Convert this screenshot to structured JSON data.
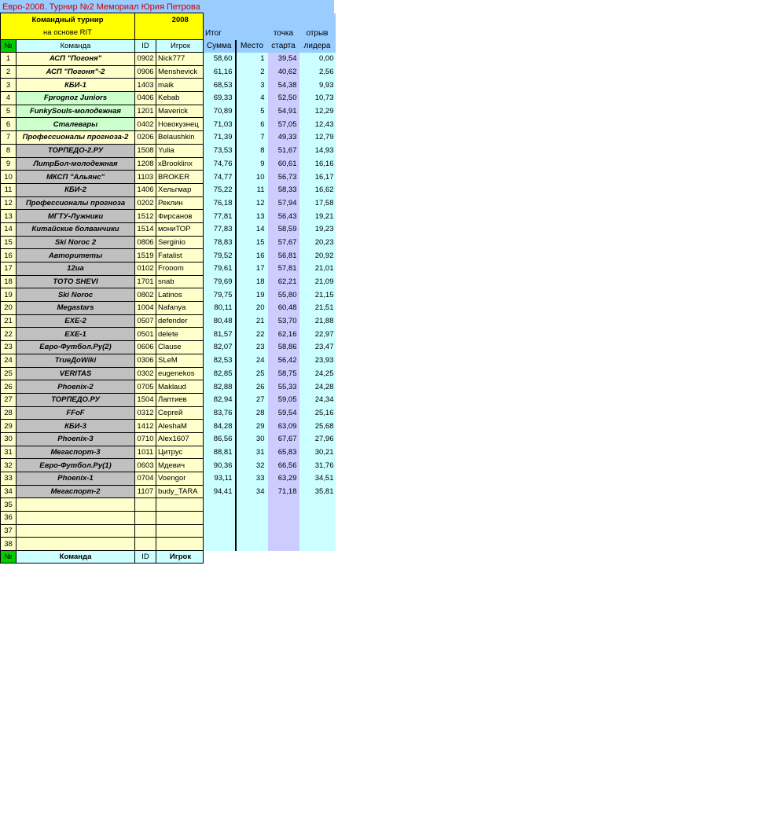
{
  "title": "Евро-2008. Турнир №2 Мемориал Юрия Петрова",
  "header": {
    "team_line1": "Командный турнир",
    "team_line2": "на основе RIT",
    "year": "2008",
    "col_num": "№",
    "col_team": "Команда",
    "col_id": "ID",
    "col_player": "Игрок",
    "itog": "Итог",
    "summa": "Сумма",
    "mesto": "Место",
    "tochka": "точка",
    "starta": "старта",
    "otryv": "отрыв",
    "lidera": "лидера"
  },
  "rows": [
    {
      "n": "1",
      "team": "АСП \"Погоня\"",
      "id": "0902",
      "player": "Nick777",
      "sum": "58,60",
      "place": "1",
      "start": "39,54",
      "gap": "0,00",
      "color": "yel"
    },
    {
      "n": "2",
      "team": "АСП \"Погоня\"-2",
      "id": "0906",
      "player": "Menshevick",
      "sum": "61,16",
      "place": "2",
      "start": "40,62",
      "gap": "2,56",
      "color": "yel"
    },
    {
      "n": "3",
      "team": "КБИ-1",
      "id": "1403",
      "player": "maik",
      "sum": "68,53",
      "place": "3",
      "start": "54,38",
      "gap": "9,93",
      "color": "yel"
    },
    {
      "n": "4",
      "team": "Fprognoz Juniors",
      "id": "0406",
      "player": "Kebab",
      "sum": "69,33",
      "place": "4",
      "start": "52,50",
      "gap": "10,73",
      "color": "grn"
    },
    {
      "n": "5",
      "team": "FunkySouls-молодежная",
      "id": "1201",
      "player": "Maverick",
      "sum": "70,89",
      "place": "5",
      "start": "54,91",
      "gap": "12,29",
      "color": "grn"
    },
    {
      "n": "6",
      "team": "Сталевары",
      "id": "0402",
      "player": "Новокузнец",
      "sum": "71,03",
      "place": "6",
      "start": "57,05",
      "gap": "12,43",
      "color": "grn"
    },
    {
      "n": "7",
      "team": "Профессионалы прогноза-2",
      "id": "0206",
      "player": "Belaushkin",
      "sum": "71,39",
      "place": "7",
      "start": "49,33",
      "gap": "12,79",
      "color": "yel"
    },
    {
      "n": "8",
      "team": "ТОРПЕДО-2.РУ",
      "id": "1508",
      "player": "Yulia",
      "sum": "73,53",
      "place": "8",
      "start": "51,67",
      "gap": "14,93",
      "color": "gry"
    },
    {
      "n": "9",
      "team": "ЛитрБол-молодежная",
      "id": "1208",
      "player": "xBrooklinx",
      "sum": "74,76",
      "place": "9",
      "start": "60,61",
      "gap": "16,16",
      "color": "gry"
    },
    {
      "n": "10",
      "team": "МКСП \"Альянс\"",
      "id": "1103",
      "player": "BROKER",
      "sum": "74,77",
      "place": "10",
      "start": "56,73",
      "gap": "16,17",
      "color": "gry"
    },
    {
      "n": "11",
      "team": "КБИ-2",
      "id": "1406",
      "player": "Хельгмар",
      "sum": "75,22",
      "place": "11",
      "start": "58,33",
      "gap": "16,62",
      "color": "gry"
    },
    {
      "n": "12",
      "team": "Профессионалы прогноза",
      "id": "0202",
      "player": "Реклин",
      "sum": "76,18",
      "place": "12",
      "start": "57,94",
      "gap": "17,58",
      "color": "gry"
    },
    {
      "n": "13",
      "team": "МГТУ-Лужники",
      "id": "1512",
      "player": "Фирсанов",
      "sum": "77,81",
      "place": "13",
      "start": "56,43",
      "gap": "19,21",
      "color": "gry"
    },
    {
      "n": "14",
      "team": "Китайские болванчики",
      "id": "1514",
      "player": "мониТОР",
      "sum": "77,83",
      "place": "14",
      "start": "58,59",
      "gap": "19,23",
      "color": "gry"
    },
    {
      "n": "15",
      "team": "Ski Noroc 2",
      "id": "0806",
      "player": "Serginio",
      "sum": "78,83",
      "place": "15",
      "start": "57,67",
      "gap": "20,23",
      "color": "gry"
    },
    {
      "n": "16",
      "team": "Авторитеты",
      "id": "1519",
      "player": "Fatalist",
      "sum": "79,52",
      "place": "16",
      "start": "56,81",
      "gap": "20,92",
      "color": "gry"
    },
    {
      "n": "17",
      "team": "12ua",
      "id": "0102",
      "player": "Frooom",
      "sum": "79,61",
      "place": "17",
      "start": "57,81",
      "gap": "21,01",
      "color": "gry"
    },
    {
      "n": "18",
      "team": "TOTO SHEVI",
      "id": "1701",
      "player": "snab",
      "sum": "79,69",
      "place": "18",
      "start": "62,21",
      "gap": "21,09",
      "color": "gry"
    },
    {
      "n": "19",
      "team": "Ski Noroc",
      "id": "0802",
      "player": "Latinos",
      "sum": "79,75",
      "place": "19",
      "start": "55,80",
      "gap": "21,15",
      "color": "gry"
    },
    {
      "n": "20",
      "team": "Megastars",
      "id": "1004",
      "player": "Nafanya",
      "sum": "80,11",
      "place": "20",
      "start": "60,48",
      "gap": "21,51",
      "color": "gry"
    },
    {
      "n": "21",
      "team": "EXE-2",
      "id": "0507",
      "player": "defender",
      "sum": "80,48",
      "place": "21",
      "start": "53,70",
      "gap": "21,88",
      "color": "gry"
    },
    {
      "n": "22",
      "team": "EXE-1",
      "id": "0501",
      "player": "delete",
      "sum": "81,57",
      "place": "22",
      "start": "62,16",
      "gap": "22,97",
      "color": "gry"
    },
    {
      "n": "23",
      "team": "Евро-Футбол.Ру(2)",
      "id": "0606",
      "player": "Clause",
      "sum": "82,07",
      "place": "23",
      "start": "58,86",
      "gap": "23,47",
      "color": "gry"
    },
    {
      "n": "24",
      "team": "TrueДоWiki",
      "id": "0306",
      "player": "SLeM",
      "sum": "82,53",
      "place": "24",
      "start": "56,42",
      "gap": "23,93",
      "color": "gry"
    },
    {
      "n": "25",
      "team": "VERITAS",
      "id": "0302",
      "player": "eugenekos",
      "sum": "82,85",
      "place": "25",
      "start": "58,75",
      "gap": "24,25",
      "color": "gry"
    },
    {
      "n": "26",
      "team": "Phoenix-2",
      "id": "0705",
      "player": "Maklaud",
      "sum": "82,88",
      "place": "26",
      "start": "55,33",
      "gap": "24,28",
      "color": "gry"
    },
    {
      "n": "27",
      "team": "ТОРПЕДО.РУ",
      "id": "1504",
      "player": "Лаптиев",
      "sum": "82,94",
      "place": "27",
      "start": "59,05",
      "gap": "24,34",
      "color": "gry"
    },
    {
      "n": "28",
      "team": "FFoF",
      "id": "0312",
      "player": "Сергей",
      "sum": "83,76",
      "place": "28",
      "start": "59,54",
      "gap": "25,16",
      "color": "gry"
    },
    {
      "n": "29",
      "team": "КБИ-3",
      "id": "1412",
      "player": "AleshaM",
      "sum": "84,28",
      "place": "29",
      "start": "63,09",
      "gap": "25,68",
      "color": "gry"
    },
    {
      "n": "30",
      "team": "Phoenix-3",
      "id": "0710",
      "player": "Alex1607",
      "sum": "86,56",
      "place": "30",
      "start": "67,67",
      "gap": "27,96",
      "color": "gry"
    },
    {
      "n": "31",
      "team": "Мегаспорт-3",
      "id": "1011",
      "player": "Цитрус",
      "sum": "88,81",
      "place": "31",
      "start": "65,83",
      "gap": "30,21",
      "color": "gry"
    },
    {
      "n": "32",
      "team": "Евро-Футбол.Ру(1)",
      "id": "0603",
      "player": "Мдевич",
      "sum": "90,36",
      "place": "32",
      "start": "66,56",
      "gap": "31,76",
      "color": "gry"
    },
    {
      "n": "33",
      "team": "Phoenix-1",
      "id": "0704",
      "player": "Voengor",
      "sum": "93,11",
      "place": "33",
      "start": "63,29",
      "gap": "34,51",
      "color": "gry"
    },
    {
      "n": "34",
      "team": "Мегаспорт-2",
      "id": "1107",
      "player": "budy_TARA",
      "sum": "94,41",
      "place": "34",
      "start": "71,18",
      "gap": "35,81",
      "color": "gry"
    },
    {
      "n": "35",
      "team": "",
      "id": "",
      "player": "",
      "sum": "",
      "place": "",
      "start": "",
      "gap": "",
      "color": "yel"
    },
    {
      "n": "36",
      "team": "",
      "id": "",
      "player": "",
      "sum": "",
      "place": "",
      "start": "",
      "gap": "",
      "color": "yel"
    },
    {
      "n": "37",
      "team": "",
      "id": "",
      "player": "",
      "sum": "",
      "place": "",
      "start": "",
      "gap": "",
      "color": "yel"
    },
    {
      "n": "38",
      "team": "",
      "id": "",
      "player": "",
      "sum": "",
      "place": "",
      "start": "",
      "gap": "",
      "color": "yel"
    }
  ],
  "footer": {
    "num": "№",
    "team": "Команда",
    "id": "ID",
    "player": "Игрок"
  }
}
